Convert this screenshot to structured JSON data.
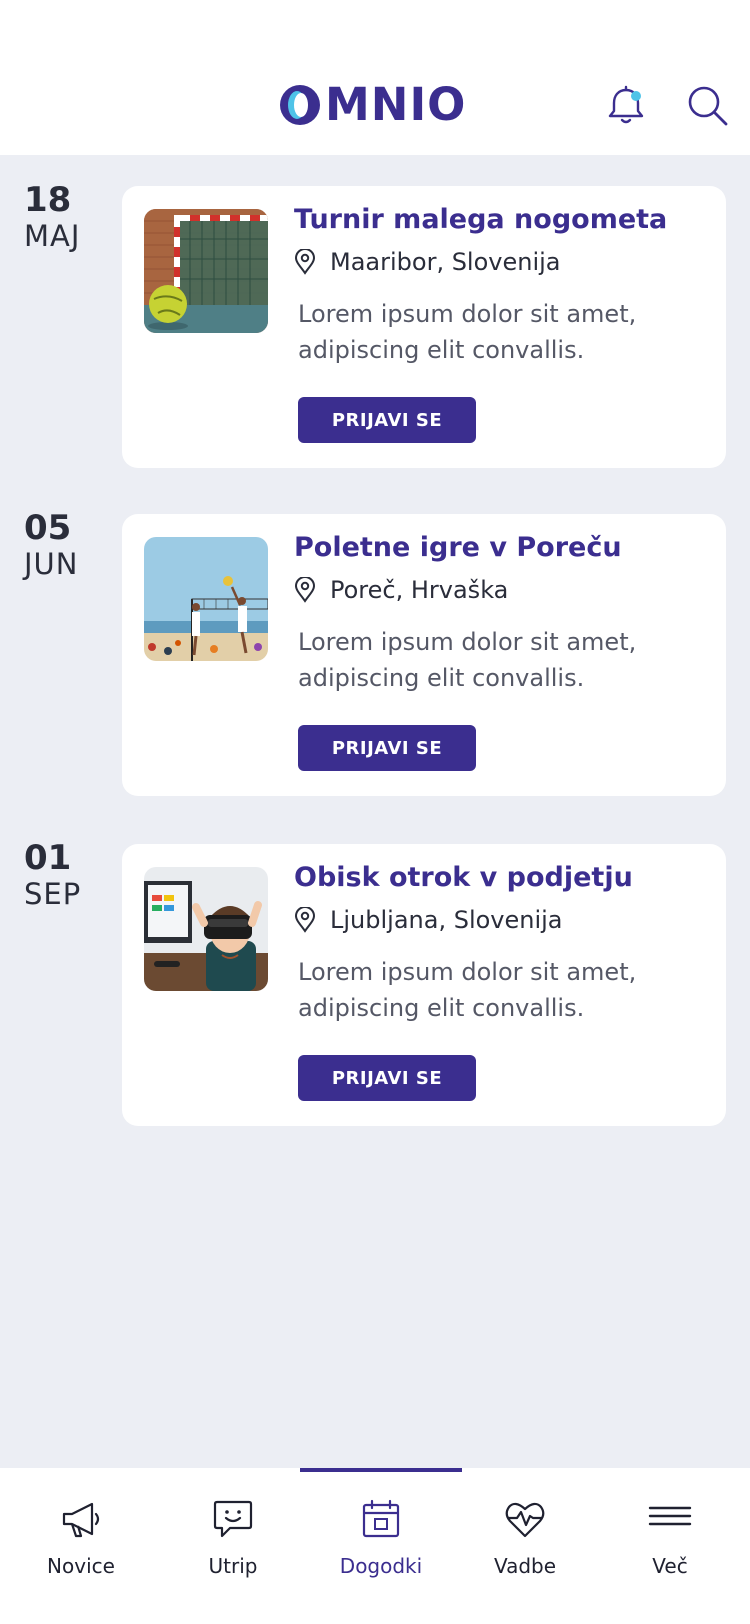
{
  "header": {
    "logo_text": "MNIO",
    "logo_alt": "OMNIO",
    "brand_color": "#3B2E8F",
    "accent_color": "#4FC3E8"
  },
  "events": [
    {
      "day": "18",
      "month": "MAJ",
      "title": "Turnir malega nogometa",
      "location": "Maaribor, Slovenija",
      "description": "Lorem ipsum dolor sit amet, adipiscing elit convallis.",
      "button_label": "PRIJAVI SE",
      "image": "futsal-ball-goal"
    },
    {
      "day": "05",
      "month": "JUN",
      "title": "Poletne igre v Poreču",
      "location": "Poreč, Hrvaška",
      "description": "Lorem ipsum dolor sit amet, adipiscing elit convallis.",
      "button_label": "PRIJAVI SE",
      "image": "beach-volleyball"
    },
    {
      "day": "01",
      "month": "SEP",
      "title": "Obisk otrok v podjetju",
      "location": "Ljubljana, Slovenija",
      "description": "Lorem ipsum dolor sit amet, adipiscing elit convallis.",
      "button_label": "PRIJAVI SE",
      "image": "child-vr-headset"
    }
  ],
  "bottom_nav": {
    "active": "Dogodki",
    "items": [
      {
        "label": "Novice",
        "icon": "megaphone-icon"
      },
      {
        "label": "Utrip",
        "icon": "chat-smile-icon"
      },
      {
        "label": "Dogodki",
        "icon": "calendar-icon"
      },
      {
        "label": "Vadbe",
        "icon": "heartbeat-icon"
      },
      {
        "label": "Več",
        "icon": "menu-icon"
      }
    ]
  }
}
